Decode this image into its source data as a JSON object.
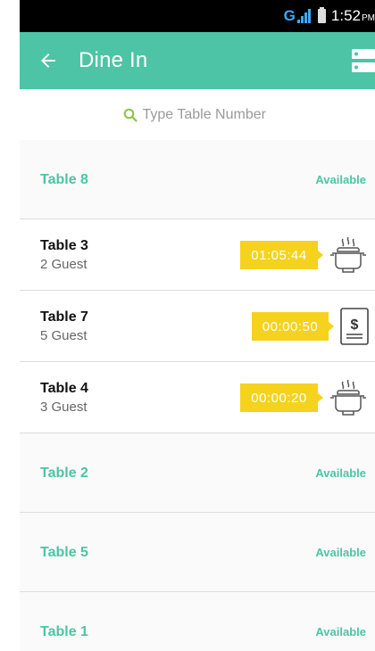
{
  "status_bar": {
    "network": "G",
    "time": "1:52",
    "ampm": "PM"
  },
  "app_bar": {
    "title": "Dine In"
  },
  "search": {
    "placeholder": "Type Table Number"
  },
  "tables": [
    {
      "name": "Table 8",
      "state": "available",
      "status": "Available"
    },
    {
      "name": "Table 3",
      "state": "occupied",
      "guests": "2 Guest",
      "timer": "01:05:44",
      "icon": "cooking-pot-icon"
    },
    {
      "name": "Table 7",
      "state": "occupied",
      "guests": "5 Guest",
      "timer": "00:00:50",
      "icon": "bill-receipt-icon"
    },
    {
      "name": "Table 4",
      "state": "occupied",
      "guests": "3 Guest",
      "timer": "00:00:20",
      "icon": "cooking-pot-icon"
    },
    {
      "name": "Table 2",
      "state": "available",
      "status": "Available"
    },
    {
      "name": "Table 5",
      "state": "available",
      "status": "Available"
    },
    {
      "name": "Table 1",
      "state": "available",
      "status": "Available"
    }
  ],
  "colors": {
    "accent": "#4dc4a6",
    "timer": "#f5d21e"
  }
}
